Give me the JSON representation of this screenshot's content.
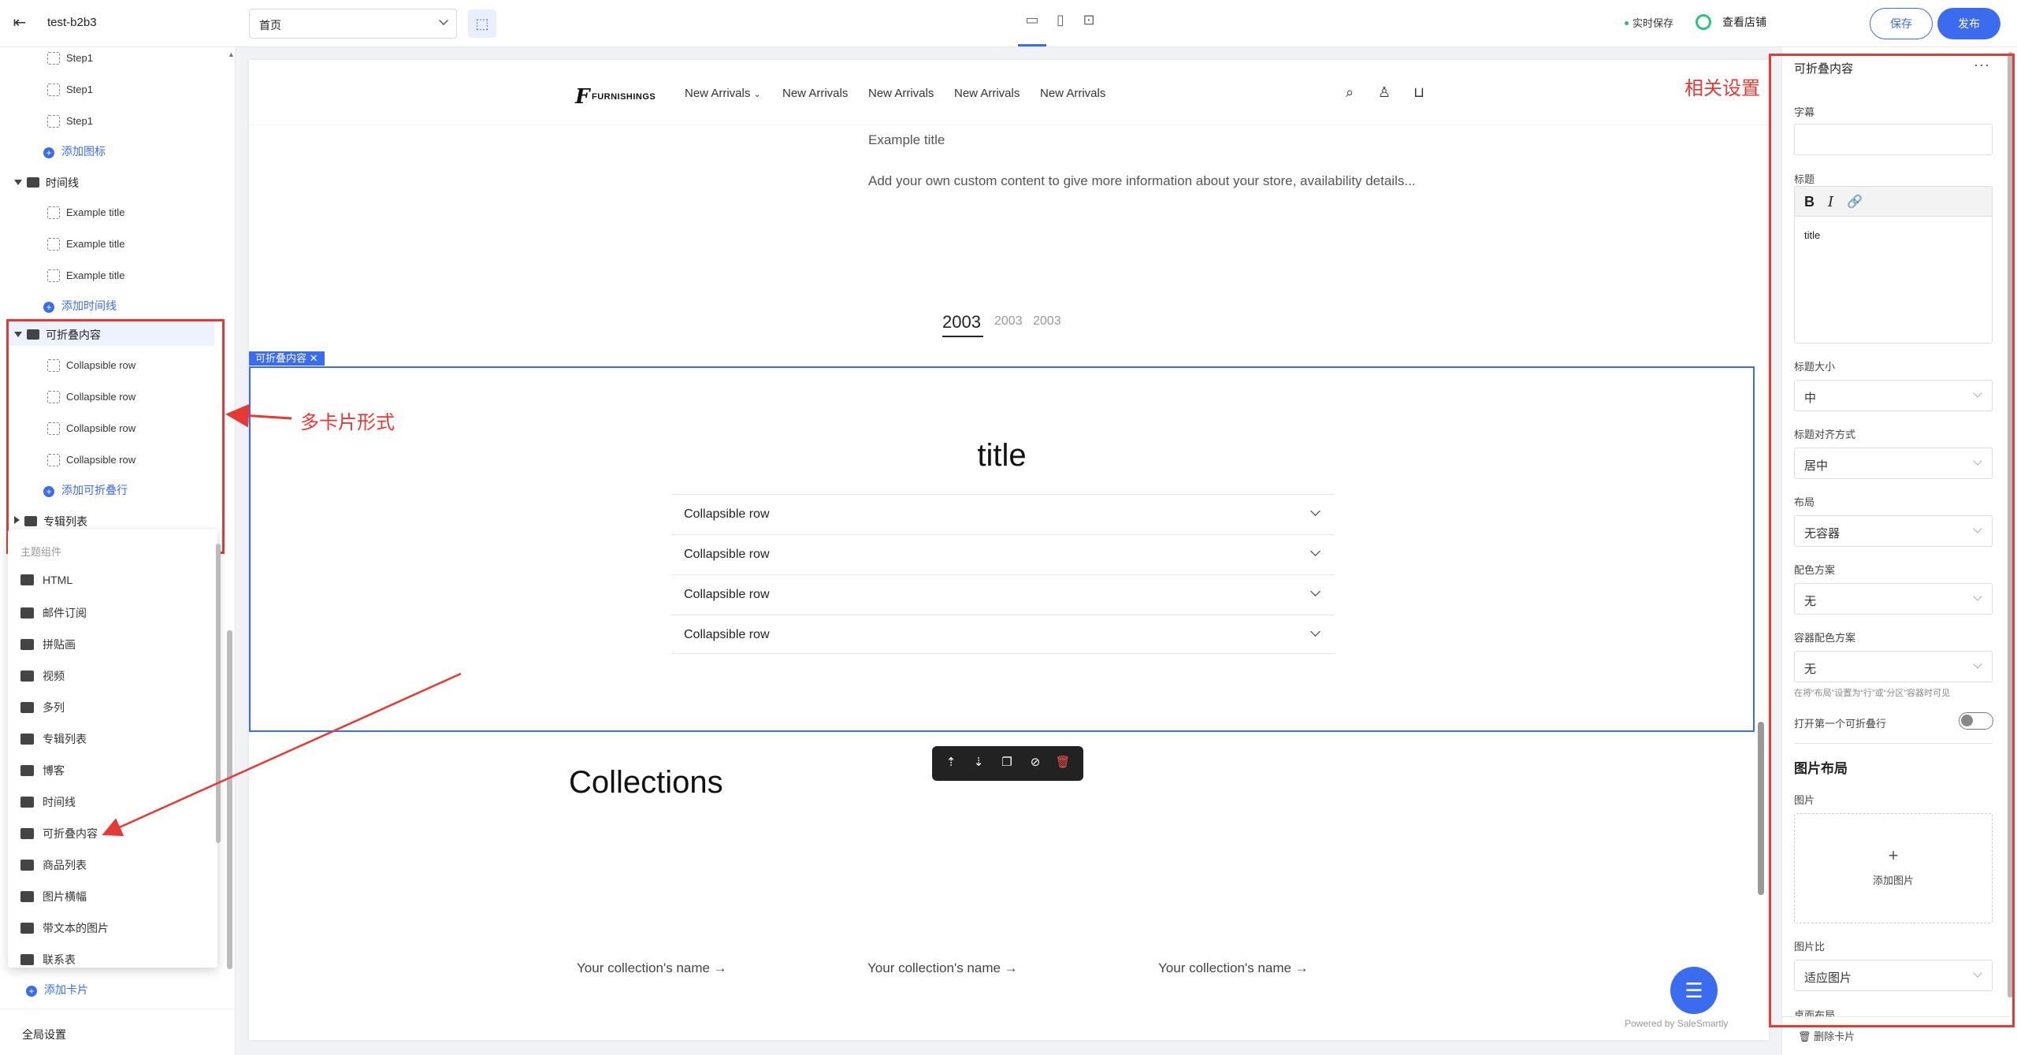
{
  "topbar": {
    "store_name": "test-b2b3",
    "page_select": "首页",
    "realtime_save": "实时保存",
    "view_store": "查看店铺",
    "save": "保存",
    "publish": "发布"
  },
  "tree": {
    "steps": [
      "Step1",
      "Step1",
      "Step1"
    ],
    "add_icon": "添加图标",
    "timeline_group": "时间线",
    "timeline_items": [
      "Example title",
      "Example title",
      "Example title"
    ],
    "add_timeline": "添加时间线",
    "collapsible_group": "可折叠内容",
    "collapsible_items": [
      "Collapsible row",
      "Collapsible row",
      "Collapsible row",
      "Collapsible row"
    ],
    "add_collapsible": "添加可折叠行",
    "collections_group": "专辑列表",
    "add_card": "添加卡片",
    "global_settings": "全局设置"
  },
  "popup": {
    "header": "主题组件",
    "items": [
      "HTML",
      "邮件订阅",
      "拼贴画",
      "视频",
      "多列",
      "专辑列表",
      "博客",
      "时间线",
      "可折叠内容",
      "商品列表",
      "图片横幅",
      "带文本的图片",
      "联系表"
    ]
  },
  "annotations": {
    "multi_card": "多卡片形式",
    "related_settings": "相关设置"
  },
  "canvas": {
    "logo": "FURNISHINGS",
    "nav": [
      "New Arrivals",
      "New Arrivals",
      "New Arrivals",
      "New Arrivals",
      "New Arrivals"
    ],
    "example_title": "Example title",
    "example_body": "Add your own custom content to give more information about your store, availability details...",
    "years": [
      "2003",
      "2003",
      "2003"
    ],
    "section_label": "可折叠内容",
    "section_title": "title",
    "rows": [
      "Collapsible row",
      "Collapsible row",
      "Collapsible row",
      "Collapsible row"
    ],
    "collections_title": "Collections",
    "collection_names": [
      "Your collection's name →",
      "Your collection's name →",
      "Your collection's name →"
    ],
    "powered_by": "Powered by SaleSmartly"
  },
  "settings": {
    "title": "可折叠内容",
    "subtitle_label": "字幕",
    "subtitle_value": "",
    "heading_label": "标题",
    "heading_value": "title",
    "heading_size_label": "标题大小",
    "heading_size": "中",
    "heading_align_label": "标题对齐方式",
    "heading_align": "居中",
    "layout_label": "布局",
    "layout": "无容器",
    "color_scheme_label": "配色方案",
    "color_scheme": "无",
    "container_color_label": "容器配色方案",
    "container_color": "无",
    "hint": "在将“布局”设置为“行”或“分区”容器时可见",
    "open_first_label": "打开第一个可折叠行",
    "open_first": false,
    "image_layout_heading": "图片布局",
    "image_label": "图片",
    "add_image": "添加图片",
    "image_ratio_label": "图片比",
    "image_ratio": "适应图片",
    "desktop_layout_label": "桌面布局",
    "delete_card": "删除卡片"
  },
  "colors": {
    "accent": "#3b6cf0",
    "annotation": "#e53935"
  }
}
